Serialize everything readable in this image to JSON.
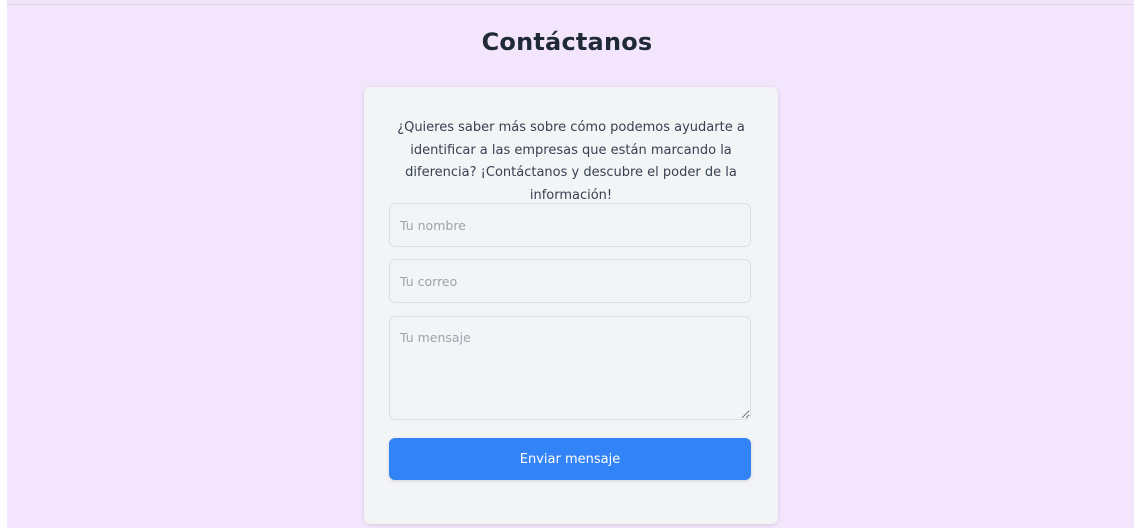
{
  "page": {
    "title": "Contáctanos"
  },
  "contact": {
    "intro": "¿Quieres saber más sobre cómo podemos ayudarte a identificar a las empresas que están marcando la diferencia? ¡Contáctanos y descubre el poder de la información!",
    "name_placeholder": "Tu nombre",
    "name_value": "",
    "email_placeholder": "Tu correo",
    "email_value": "",
    "message_placeholder": "Tu mensaje",
    "message_value": "",
    "submit_label": "Enviar mensaje"
  },
  "colors": {
    "background": "#f3e6fc",
    "card": "#f3f4f6",
    "accent": "#3283f6",
    "title": "#1f2937"
  }
}
